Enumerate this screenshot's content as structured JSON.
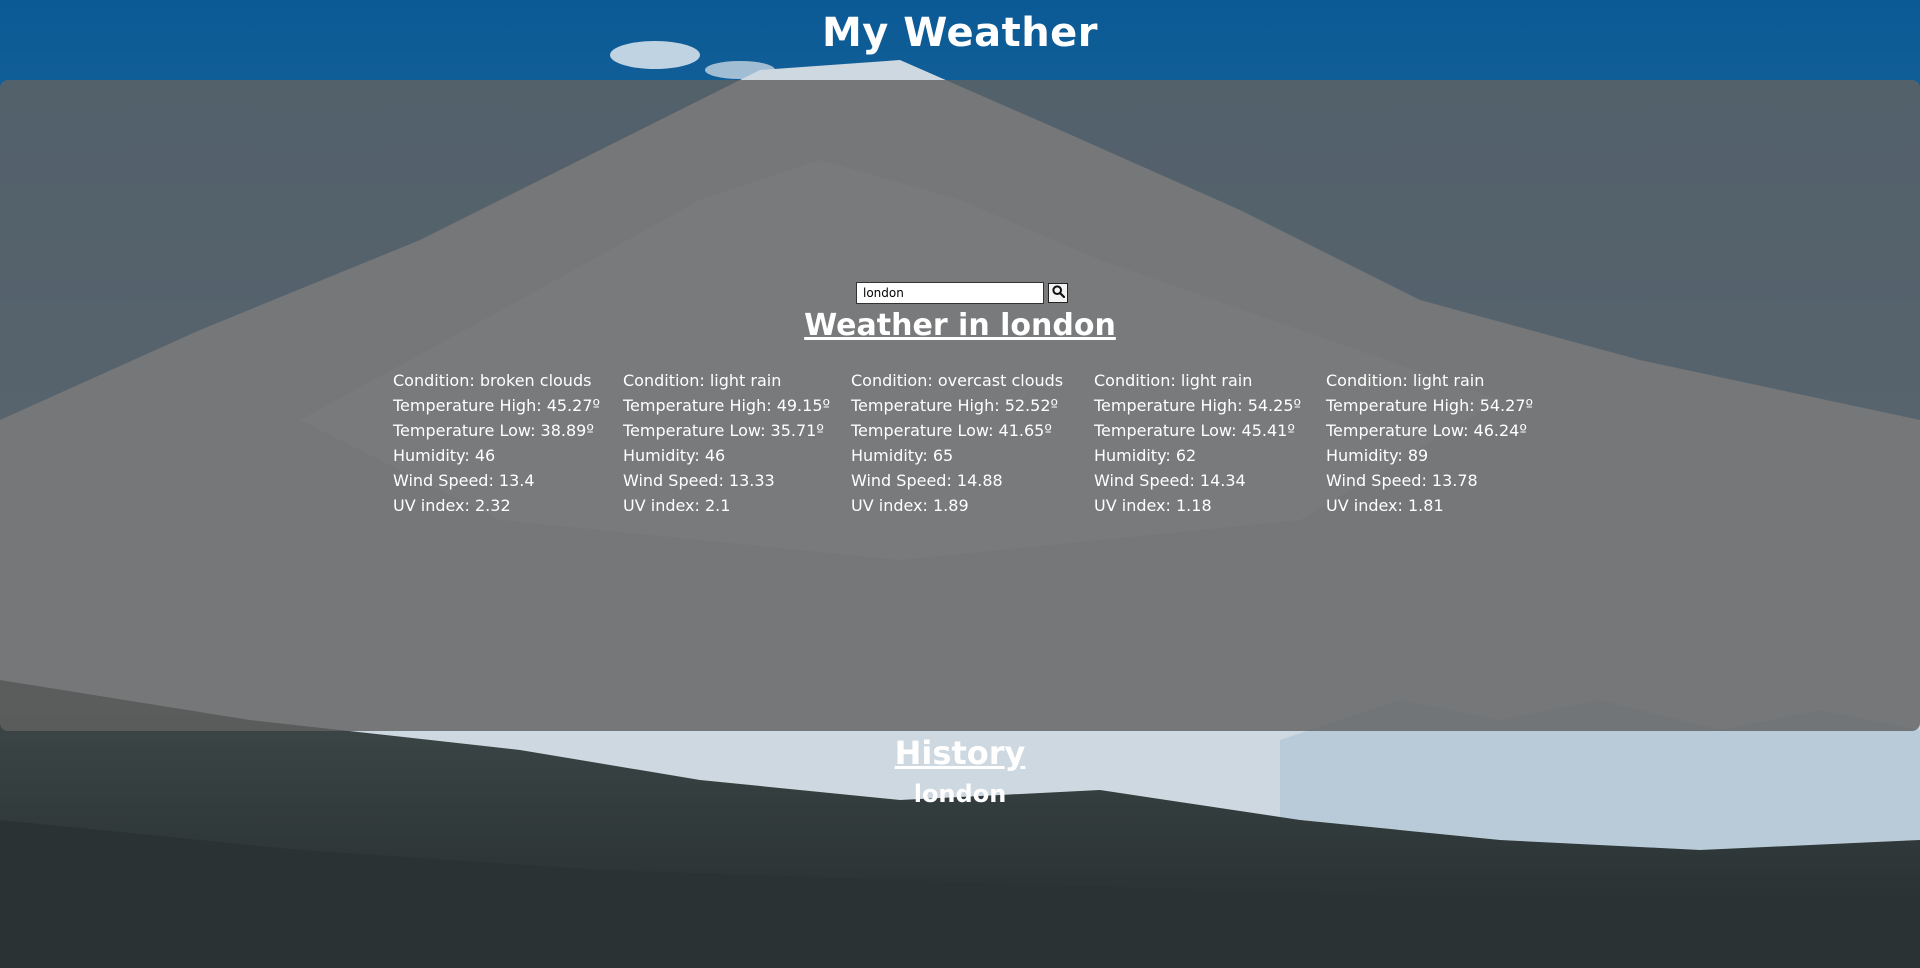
{
  "header": {
    "title": "My Weather"
  },
  "search": {
    "value": "london",
    "button_icon": "search-icon"
  },
  "weather": {
    "heading": "Weather in london",
    "days": [
      {
        "condition": "Condition: broken clouds",
        "temp_high": "Temperature High: 45.27º",
        "temp_low": "Temperature Low: 38.89º",
        "humidity": "Humidity: 46",
        "wind": "Wind Speed: 13.4",
        "uv": "UV index: 2.32"
      },
      {
        "condition": "Condition: light rain",
        "temp_high": "Temperature High: 49.15º",
        "temp_low": "Temperature Low: 35.71º",
        "humidity": "Humidity: 46",
        "wind": "Wind Speed: 13.33",
        "uv": "UV index: 2.1"
      },
      {
        "condition": "Condition: overcast clouds",
        "temp_high": "Temperature High: 52.52º",
        "temp_low": "Temperature Low: 41.65º",
        "humidity": "Humidity: 65",
        "wind": "Wind Speed: 14.88",
        "uv": "UV index: 1.89"
      },
      {
        "condition": "Condition: light rain",
        "temp_high": "Temperature High: 54.25º",
        "temp_low": "Temperature Low: 45.41º",
        "humidity": "Humidity: 62",
        "wind": "Wind Speed: 14.34",
        "uv": "UV index: 1.18"
      },
      {
        "condition": "Condition: light rain",
        "temp_high": "Temperature High: 54.27º",
        "temp_low": "Temperature Low: 46.24º",
        "humidity": "Humidity: 89",
        "wind": "Wind Speed: 13.78",
        "uv": "UV index: 1.81"
      }
    ]
  },
  "history": {
    "heading": "History",
    "items": [
      "london"
    ]
  },
  "colors": {
    "sky": "#0b5a95",
    "panel": "#626262",
    "text": "#ffffff"
  }
}
